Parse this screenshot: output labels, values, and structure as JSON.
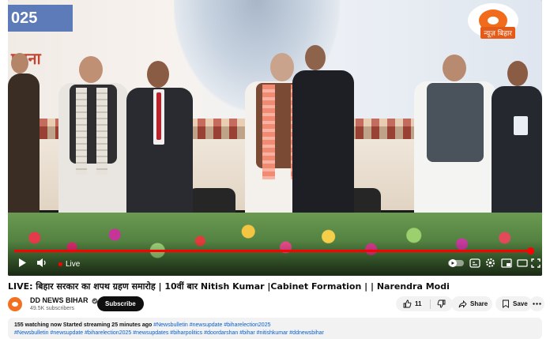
{
  "video": {
    "banner_year": "025",
    "banner_city": "पटना",
    "channel_logo_text": "न्यूज़ बिहार",
    "live_label": "Live",
    "progress_fraction": 0.99
  },
  "title": "LIVE: बिहार सरकार का शपथ ग्रहण समारोह | 10वीं बार Nitish Kumar |Cabinet Formation | | Narendra Modi",
  "channel": {
    "name": "DD NEWS BIHAR",
    "verified": true,
    "subscribers": "49.5K subscribers",
    "subscribe_label": "Subscribe"
  },
  "actions": {
    "like_count": "11",
    "share_label": "Share",
    "save_label": "Save"
  },
  "description": {
    "stats": "155 watching now  Started streaming 25 minutes ago",
    "tags_line1": "#Newsbulletin #newsupdate #biharelection2025",
    "tags_line2": "#Newsbulletin #newsupdate #biharelection2025 #newsupdates #biharpolitics #doordarshan #bihar #nitishkumar #ddnewsbihar"
  },
  "colors": {
    "accent": "#ff0000",
    "link": "#065fd4",
    "channel_orange": "#f37021"
  }
}
